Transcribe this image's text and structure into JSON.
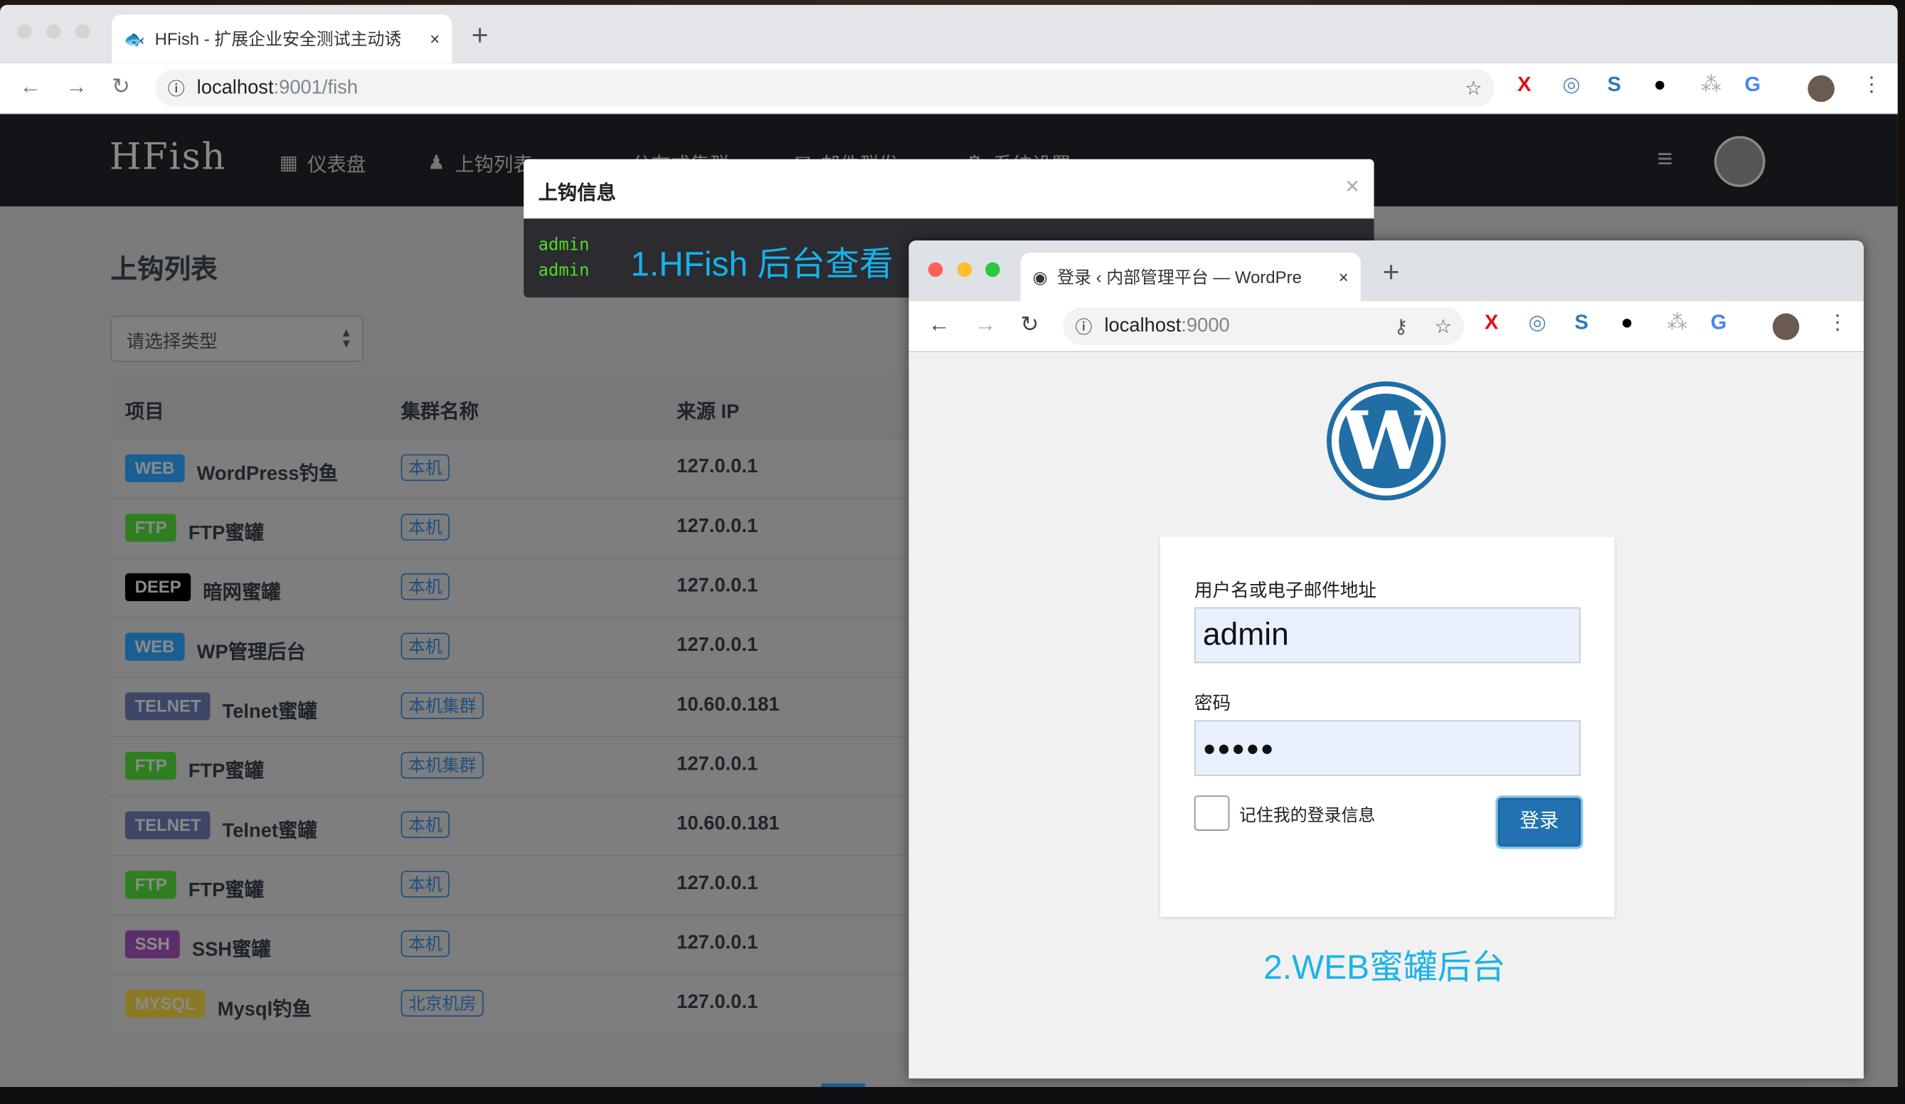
{
  "browser1": {
    "tab_title": "HFish - 扩展企业安全测试主动诱",
    "url_host": "localhost",
    "url_path": ":9001/fish",
    "new_tab": "+",
    "close": "×"
  },
  "app": {
    "logo": "HFish",
    "nav": [
      {
        "label": "仪表盘",
        "icon": "dashboard-icon"
      },
      {
        "label": "上钩列表",
        "icon": "spy-icon"
      },
      {
        "label": "分布式集群",
        "icon": "cloud-icon"
      },
      {
        "label": "邮件群发",
        "icon": "mail-icon"
      },
      {
        "label": "系统设置",
        "icon": "gear-icon"
      }
    ]
  },
  "page": {
    "title": "上钩列表",
    "select_placeholder": "请选择类型",
    "columns": [
      "项目",
      "集群名称",
      "来源 IP"
    ],
    "rows": [
      {
        "type": "WEB",
        "name": "WordPress钓鱼",
        "cluster": "本机",
        "ip": "127.0.0.1"
      },
      {
        "type": "FTP",
        "name": "FTP蜜罐",
        "cluster": "本机",
        "ip": "127.0.0.1"
      },
      {
        "type": "DEEP",
        "name": "暗网蜜罐",
        "cluster": "本机",
        "ip": "127.0.0.1"
      },
      {
        "type": "WEB",
        "name": "WP管理后台",
        "cluster": "本机",
        "ip": "127.0.0.1"
      },
      {
        "type": "TELNET",
        "name": "Telnet蜜罐",
        "cluster": "本机集群",
        "ip": "10.60.0.181"
      },
      {
        "type": "FTP",
        "name": "FTP蜜罐",
        "cluster": "本机集群",
        "ip": "127.0.0.1"
      },
      {
        "type": "TELNET",
        "name": "Telnet蜜罐",
        "cluster": "本机",
        "ip": "10.60.0.181"
      },
      {
        "type": "FTP",
        "name": "FTP蜜罐",
        "cluster": "本机",
        "ip": "127.0.0.1"
      },
      {
        "type": "SSH",
        "name": "SSH蜜罐",
        "cluster": "本机",
        "ip": "127.0.0.1"
      },
      {
        "type": "MYSQL",
        "name": "Mysql钓鱼",
        "cluster": "北京机房",
        "ip": "127.0.0.1"
      }
    ]
  },
  "badge_colors": {
    "WEB": "#1a5f93",
    "FTP": "#2f7f21",
    "DEEP": "#000000",
    "TELNET": "#3e4668",
    "SSH": "#5e2e6c",
    "MYSQL": "#8a7a26"
  },
  "modal": {
    "title": "上钩信息",
    "close": "×",
    "lines": [
      "admin",
      "admin"
    ],
    "annotation": "1.HFish 后台查看"
  },
  "browser2": {
    "tab_title": "登录 ‹ 内部管理平台 — WordPre",
    "url_host": "localhost",
    "url_port": ":9000",
    "new_tab": "+",
    "close": "×"
  },
  "login": {
    "user_label": "用户名或电子邮件地址",
    "user_value": "admin",
    "pass_label": "密码",
    "pass_value": "●●●●●",
    "remember": "记住我的登录信息",
    "submit": "登录",
    "logo": "W"
  },
  "annotation2": "2.WEB蜜罐后台"
}
